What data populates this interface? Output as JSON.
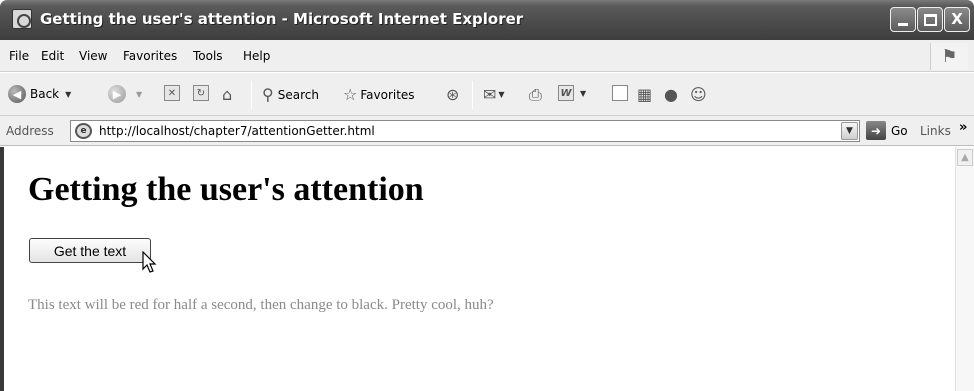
{
  "window": {
    "title": "Getting the user's attention - Microsoft Internet Explorer",
    "close_label": "X"
  },
  "menu": {
    "items": [
      "File",
      "Edit",
      "View",
      "Favorites",
      "Tools",
      "Help"
    ]
  },
  "toolbar": {
    "back_label": "Back",
    "search_label": "Search",
    "favorites_label": "Favorites"
  },
  "address": {
    "label": "Address",
    "url": "http://localhost/chapter7/attentionGetter.html",
    "go_label": "Go",
    "links_label": "Links"
  },
  "page": {
    "heading": "Getting the user's attention",
    "button_label": "Get the text",
    "message": "This text will be red for half a second, then change to black. Pretty cool, huh?"
  }
}
